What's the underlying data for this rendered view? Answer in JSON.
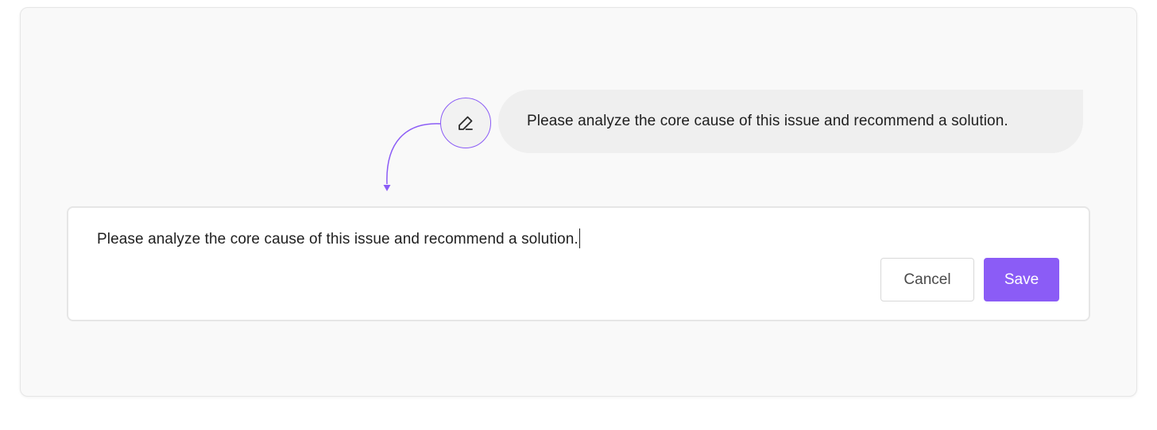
{
  "message": {
    "text": "Please analyze the core cause of this issue and recommend a solution."
  },
  "editor": {
    "value": "Please analyze the core cause of this issue and recommend a solution.",
    "cancel_label": "Cancel",
    "save_label": "Save"
  },
  "icons": {
    "edit": "pencil-icon",
    "connector": "arrow-down-icon"
  },
  "colors": {
    "accent": "#8b5cf6",
    "bubble_bg": "#efefef",
    "frame_bg": "#f9f9f9"
  }
}
